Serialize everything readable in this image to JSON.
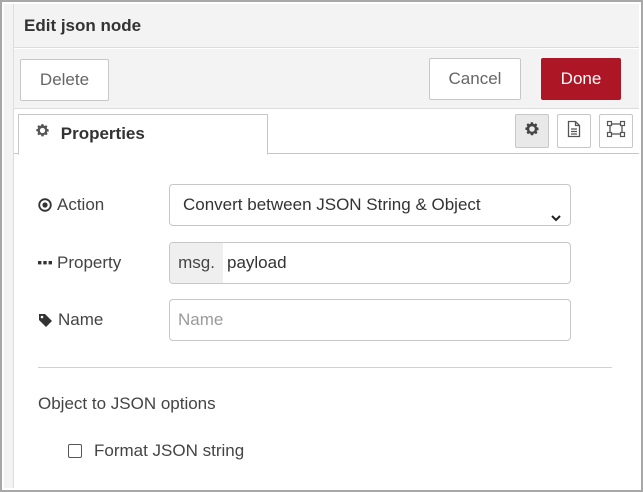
{
  "tray": {
    "title": "Edit json node"
  },
  "toolbar": {
    "delete_label": "Delete",
    "cancel_label": "Cancel",
    "done_label": "Done"
  },
  "tabs": [
    {
      "label": "Properties",
      "icon": "gear-icon"
    }
  ],
  "tab_icons": [
    "gear-icon",
    "description-icon",
    "appearance-icon"
  ],
  "form": {
    "action": {
      "label": "Action",
      "icon": "dot-circle-icon",
      "selected": "Convert between JSON String & Object"
    },
    "property": {
      "label": "Property",
      "icon": "ellipsis-icon",
      "type": "msg.",
      "value": "payload"
    },
    "name": {
      "label": "Name",
      "icon": "tag-icon",
      "placeholder": "Name",
      "value": ""
    },
    "options_title": "Object to JSON options",
    "format_checkbox": {
      "label": "Format JSON string",
      "checked": false
    }
  },
  "colors": {
    "done_button": "#ad1625",
    "header_background": "#f3f3f3",
    "border": "#c7c7c7"
  }
}
